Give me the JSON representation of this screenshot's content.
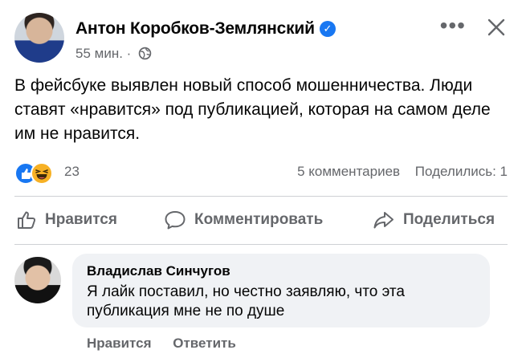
{
  "post": {
    "author": "Антон Коробков-Землянский",
    "time": "55 мин.",
    "separator": "·",
    "text": "В фейсбуке выявлен новый способ мошенничества. Люди ставят «нравится» под публикацией, которая на самом деле им не нравится."
  },
  "stats": {
    "reactions_count": "23",
    "comments": "5 комментариев",
    "shares": "Поделились: 1"
  },
  "actions": {
    "like": "Нравится",
    "comment": "Комментировать",
    "share": "Поделиться"
  },
  "comment": {
    "author": "Владислав Синчугов",
    "text": "Я лайк поставил, но честно заявляю, что эта публикация мне не по душе",
    "like": "Нравится",
    "reply": "Ответить"
  },
  "colors": {
    "accent": "#1877f2",
    "secondary_text": "#65676b",
    "bubble_bg": "#f0f2f5"
  },
  "icons": [
    "verified-badge-icon",
    "globe-icon",
    "more-icon",
    "close-icon",
    "like-reaction-icon",
    "haha-reaction-icon",
    "thumbs-up-icon",
    "comment-icon",
    "share-icon"
  ]
}
